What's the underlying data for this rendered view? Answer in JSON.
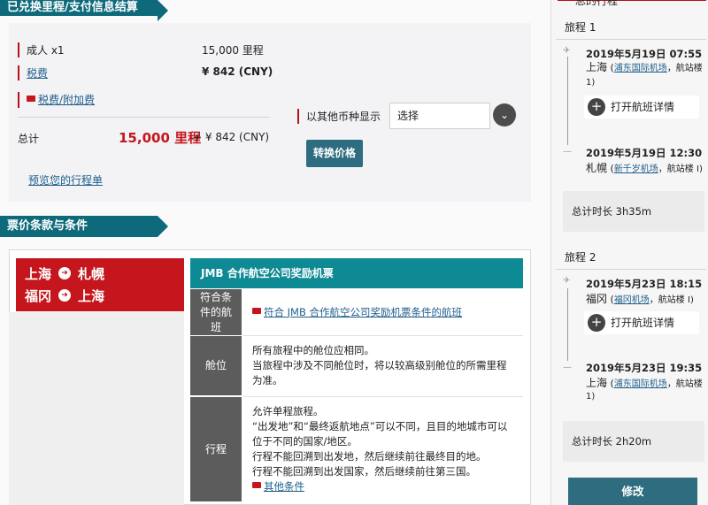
{
  "summary": {
    "header": "已兑换里程/支付信息结算",
    "rows": [
      {
        "label": "成人 x1",
        "value": "15,000 里程"
      },
      {
        "label": "税费",
        "value": "¥ 842 (CNY)"
      },
      {
        "label": "税费/附加费",
        "value": ""
      }
    ],
    "total_label": "总计",
    "total_miles": "15,000 里程",
    "total_plus": "+ ¥ 842 (CNY)",
    "preview_link": "预览您的行程单",
    "currency_label": "以其他币种显示",
    "currency_select": "选择",
    "convert_button": "转换价格"
  },
  "terms": {
    "header": "票价条款与条件",
    "route": {
      "row1_from": "上海",
      "row1_to": "札幌",
      "row2_from": "福冈",
      "row2_to": "上海"
    },
    "fare_title": "JMB 合作航空公司奖励机票",
    "items": [
      {
        "label": "符合条件的航班",
        "body": [
          "符合 JMB 合作航空公司奖励机票条件的航班"
        ]
      },
      {
        "label": "舱位",
        "body": [
          "所有旅程中的舱位应相同。",
          "当旅程中涉及不同舱位时，将以较高级别舱位的所需里程为准。"
        ]
      },
      {
        "label": "行程",
        "body": [
          "允许单程旅程。",
          "“出发地”和“最终返航地点”可以不同，且目的地城市可以位于不同的国家/地区。",
          "行程不能回溯到出发地，然后继续前往最终目的地。",
          "行程不能回溯到出发国家，然后继续前往第三国。"
        ],
        "link": "其他条件"
      }
    ]
  },
  "itinerary": {
    "title": "总的行程",
    "legs": [
      {
        "label": "旅程 1",
        "dep_datetime": "2019年5月19日 07:55",
        "dep_city": "上海",
        "dep_airport": "浦东国际机场",
        "dep_terminal": "，航站楼 1)",
        "detail_button": "打开航班详情",
        "arr_datetime": "2019年5月19日 12:30",
        "arr_city": "札幌",
        "arr_airport": "新千岁机场",
        "arr_terminal": "，航站楼 I)",
        "total_label": "总计时长 3h35m"
      },
      {
        "label": "旅程 2",
        "dep_datetime": "2019年5月23日 18:15",
        "dep_city": "福冈",
        "dep_airport": "福冈机场",
        "dep_terminal": "，航站楼 I)",
        "detail_button": "打开航班详情",
        "arr_datetime": "2019年5月23日 19:35",
        "arr_city": "上海",
        "arr_airport": "浦东国际机场",
        "arr_terminal": "，航站楼 1)",
        "total_label": "总计时长 2h20m"
      }
    ],
    "modify_button": "修改"
  },
  "colors": {
    "brand_red": "#c4161c",
    "teal": "#0e6a7a",
    "button": "#2e6c7f"
  }
}
